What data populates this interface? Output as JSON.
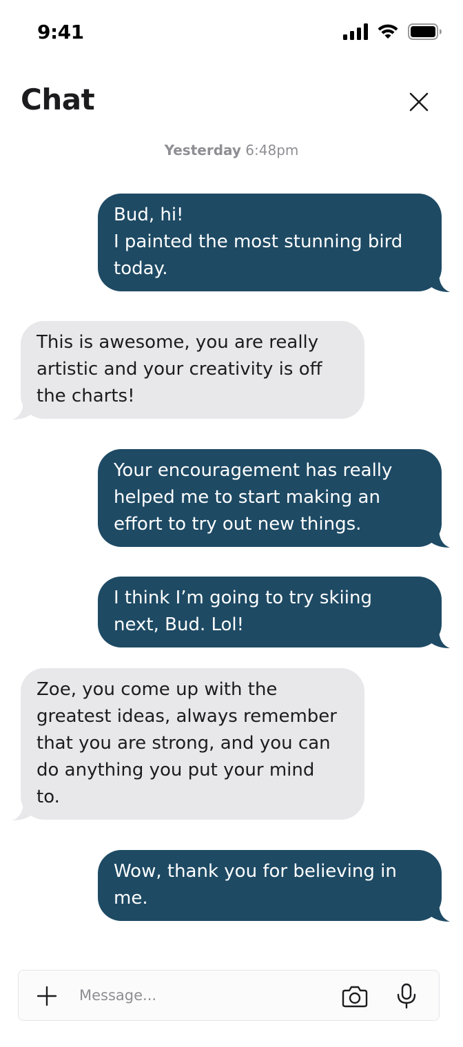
{
  "status_bar": {
    "time": "9:41",
    "icons": [
      "signal-icon",
      "wifi-icon",
      "battery-icon"
    ]
  },
  "header": {
    "title": "Chat",
    "close_icon": "close-icon"
  },
  "timestamp": {
    "day": "Yesterday",
    "time": "6:48pm"
  },
  "messages": [
    {
      "direction": "sent",
      "lines": [
        "Bud, hi!",
        "I painted the most stunning bird",
        "today."
      ]
    },
    {
      "direction": "received",
      "lines": [
        "This is awesome, you are really",
        "artistic and your creativity is off",
        "the charts!"
      ]
    },
    {
      "direction": "sent",
      "lines": [
        "Your encouragement has really",
        "helped me to start making an",
        "effort to try out new things."
      ]
    },
    {
      "direction": "sent",
      "lines": [
        "I think I’m going to try skiing",
        "next, Bud. Lol!"
      ]
    },
    {
      "direction": "received",
      "lines": [
        "Zoe, you come up with the",
        "greatest ideas, always remember",
        "that you are strong, and you can",
        "do anything you put your mind",
        "to."
      ]
    },
    {
      "direction": "sent",
      "lines": [
        "Wow, thank you for believing in",
        "me."
      ]
    }
  ],
  "composer": {
    "placeholder": "Message...",
    "value": "",
    "icons": [
      "plus-icon",
      "camera-icon",
      "microphone-icon"
    ]
  },
  "colors": {
    "sent_bubble": "#1e4a64",
    "received_bubble": "#e8e8eb",
    "timestamp_text": "#8e8e93"
  }
}
